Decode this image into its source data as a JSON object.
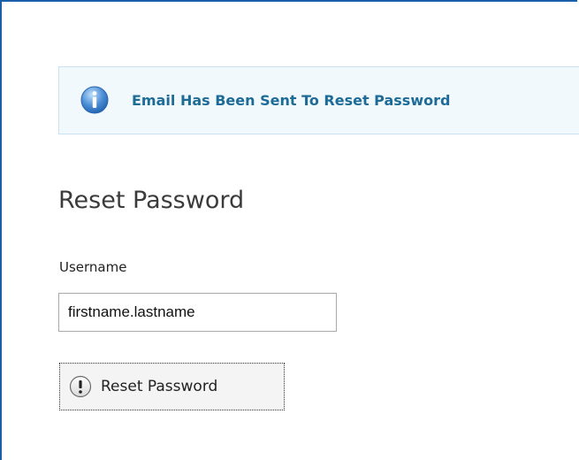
{
  "notice": {
    "icon": "info-icon",
    "message": "Email Has Been Sent To Reset Password",
    "color": "#1d6c98"
  },
  "form": {
    "title": "Reset Password",
    "username_label": "Username",
    "username_value": "firstname.lastname"
  },
  "button": {
    "icon": "exclamation-icon",
    "label": "Reset Password"
  },
  "colors": {
    "frame_border": "#1c5fa8",
    "notice_background": "#f2f9fd",
    "notice_border": "#c9e1f1"
  }
}
